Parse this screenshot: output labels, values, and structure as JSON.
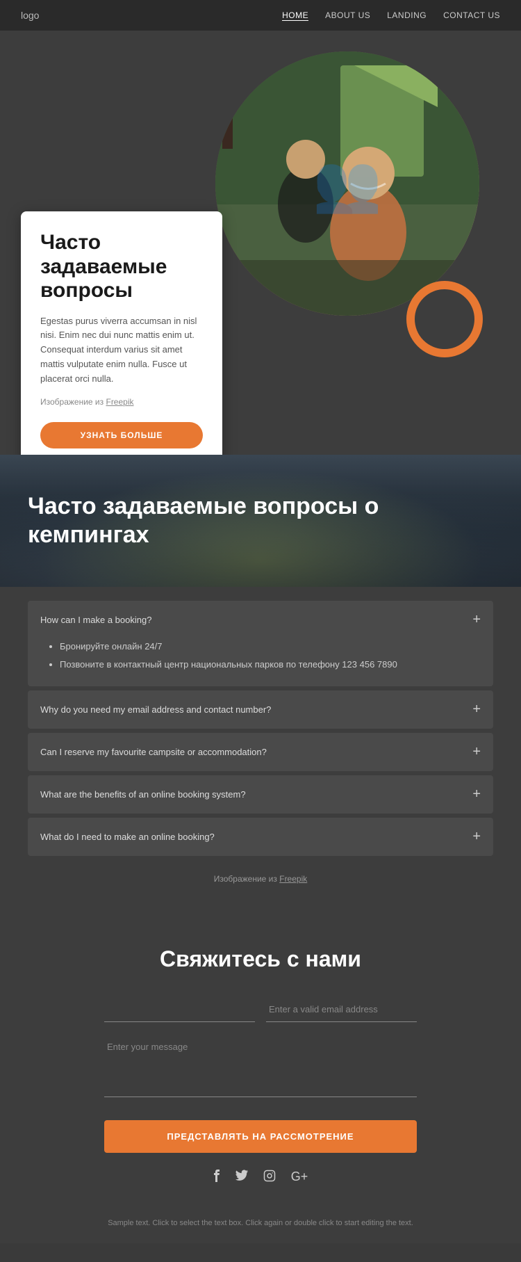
{
  "nav": {
    "logo": "logo",
    "links": [
      {
        "label": "HOME",
        "id": "home",
        "active": true
      },
      {
        "label": "ABOUT US",
        "id": "about"
      },
      {
        "label": "LANDING",
        "id": "landing"
      },
      {
        "label": "CONTACT US",
        "id": "contact"
      }
    ]
  },
  "hero": {
    "heading": "Часто задаваемые вопросы",
    "body": "Egestas purus viverra accumsan in nisl nisi. Enim nec dui nunc mattis enim ut. Consequat interdum varius sit amet mattis vulputate enim nulla. Fusce ut placerat orci nulla.",
    "freepik_note": "Изображение из",
    "freepik_link": "Freepik",
    "button_label": "УЗНАТЬ БОЛЬШЕ"
  },
  "faq_banner": {
    "heading": "Часто задаваемые вопросы о кемпингах"
  },
  "faq_items": [
    {
      "id": 1,
      "question": "How can I make a booking?",
      "open": true,
      "answer_items": [
        "Бронируйте онлайн 24/7",
        "Позвоните в контактный центр национальных парков по телефону 123 456 7890"
      ]
    },
    {
      "id": 2,
      "question": "Why do you need my email address and contact number?",
      "open": false,
      "answer_items": []
    },
    {
      "id": 3,
      "question": "Can I reserve my favourite campsite or accommodation?",
      "open": false,
      "answer_items": []
    },
    {
      "id": 4,
      "question": "What are the benefits of an online booking system?",
      "open": false,
      "answer_items": []
    },
    {
      "id": 5,
      "question": "What do I need to make an online booking?",
      "open": false,
      "answer_items": []
    }
  ],
  "freepik_small": "Изображение из",
  "freepik_small_link": "Freepik",
  "contact": {
    "heading": "Свяжитесь с нами",
    "name_placeholder": "",
    "email_placeholder": "Enter a valid email address",
    "message_placeholder": "Enter your message",
    "submit_label": "ПРЕДСТАВЛЯТЬ НА РАССМОТРЕНИЕ"
  },
  "social": {
    "icons": [
      "f",
      "t",
      "ig",
      "g+"
    ]
  },
  "footer": {
    "note": "Sample text. Click to select the text box. Click again or double click to start editing the text."
  }
}
